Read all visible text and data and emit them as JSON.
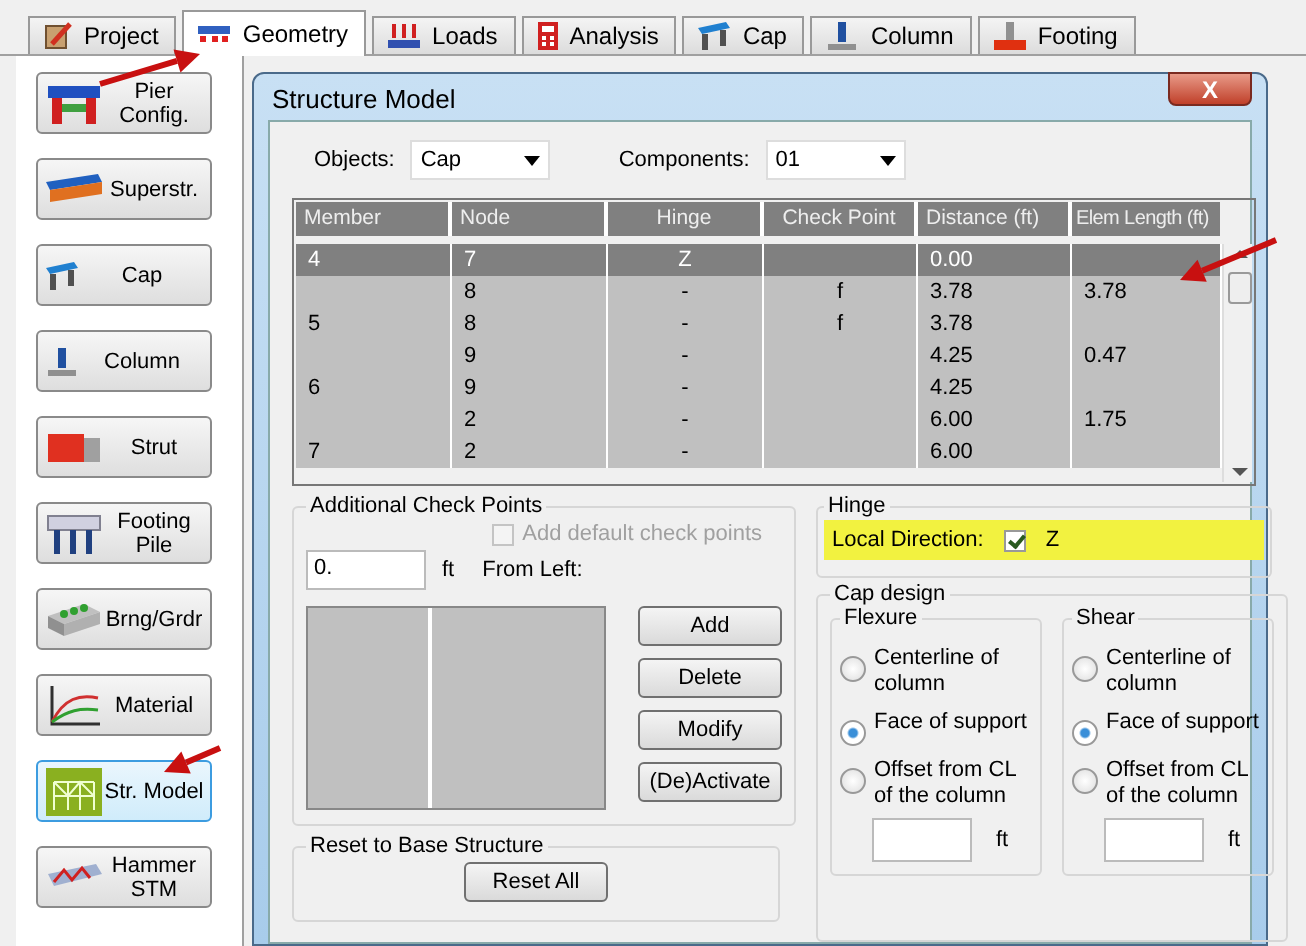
{
  "tabs": [
    {
      "label": "Project",
      "selected": false
    },
    {
      "label": "Geometry",
      "selected": true
    },
    {
      "label": "Loads",
      "selected": false
    },
    {
      "label": "Analysis",
      "selected": false
    },
    {
      "label": "Cap",
      "selected": false
    },
    {
      "label": "Column",
      "selected": false
    },
    {
      "label": "Footing",
      "selected": false
    }
  ],
  "sidebar": {
    "items": [
      {
        "label": "Pier\nConfig.",
        "selected": false
      },
      {
        "label": "Superstr.",
        "selected": false
      },
      {
        "label": "Cap",
        "selected": false
      },
      {
        "label": "Column",
        "selected": false
      },
      {
        "label": "Strut",
        "selected": false
      },
      {
        "label": "Footing\nPile",
        "selected": false
      },
      {
        "label": "Brng/Grdr",
        "selected": false
      },
      {
        "label": "Material",
        "selected": false
      },
      {
        "label": "Str. Model",
        "selected": true
      },
      {
        "label": "Hammer\nSTM",
        "selected": false
      }
    ]
  },
  "dialog": {
    "title": "Structure Model",
    "close": "X",
    "objects": {
      "label": "Objects:",
      "value": "Cap"
    },
    "components": {
      "label": "Components:",
      "value": "01"
    },
    "table": {
      "columns": [
        "Member",
        "Node",
        "Hinge",
        "Check Point",
        "Distance (ft)",
        "Elem Length (ft)"
      ],
      "rows": [
        {
          "cells": [
            "4",
            "7",
            "Z",
            "",
            "0.00",
            ""
          ],
          "selected": true
        },
        {
          "cells": [
            "",
            "8",
            "-",
            "f",
            "3.78",
            "3.78"
          ],
          "selected": false
        },
        {
          "cells": [
            "5",
            "8",
            "-",
            "f",
            "3.78",
            ""
          ],
          "selected": false
        },
        {
          "cells": [
            "",
            "9",
            "-",
            "",
            "4.25",
            "0.47"
          ],
          "selected": false
        },
        {
          "cells": [
            "6",
            "9",
            "-",
            "",
            "4.25",
            ""
          ],
          "selected": false
        },
        {
          "cells": [
            "",
            "2",
            "-",
            "",
            "6.00",
            "1.75"
          ],
          "selected": false
        },
        {
          "cells": [
            "7",
            "2",
            "-",
            "",
            "6.00",
            ""
          ],
          "selected": false
        }
      ]
    },
    "check_points": {
      "title": "Additional Check Points",
      "default_checkbox": {
        "label": "Add default check points",
        "checked": false,
        "disabled": true
      },
      "value": "0.",
      "unit": "ft",
      "from_left": "From Left:",
      "buttons": [
        "Add",
        "Delete",
        "Modify",
        "(De)Activate"
      ]
    },
    "reset": {
      "title": "Reset to Base Structure",
      "button": "Reset All"
    },
    "hinge": {
      "title": "Hinge",
      "label": "Local Direction:",
      "checked": true,
      "direction": "Z",
      "highlighted": true
    },
    "cap_design": {
      "title": "Cap design",
      "groups": [
        {
          "title": "Flexure",
          "options": [
            {
              "label": "Centerline of column",
              "selected": false
            },
            {
              "label": "Face of support",
              "selected": true
            },
            {
              "label": "Offset from CL of the column",
              "selected": false
            }
          ],
          "unit": "ft"
        },
        {
          "title": "Shear",
          "options": [
            {
              "label": "Centerline of column",
              "selected": false
            },
            {
              "label": "Face of support",
              "selected": true
            },
            {
              "label": "Offset from CL of the column",
              "selected": false
            }
          ],
          "unit": "ft"
        }
      ]
    }
  },
  "annotations": [
    {
      "kind": "arrow"
    },
    {
      "kind": "arrow"
    },
    {
      "kind": "arrow"
    }
  ]
}
